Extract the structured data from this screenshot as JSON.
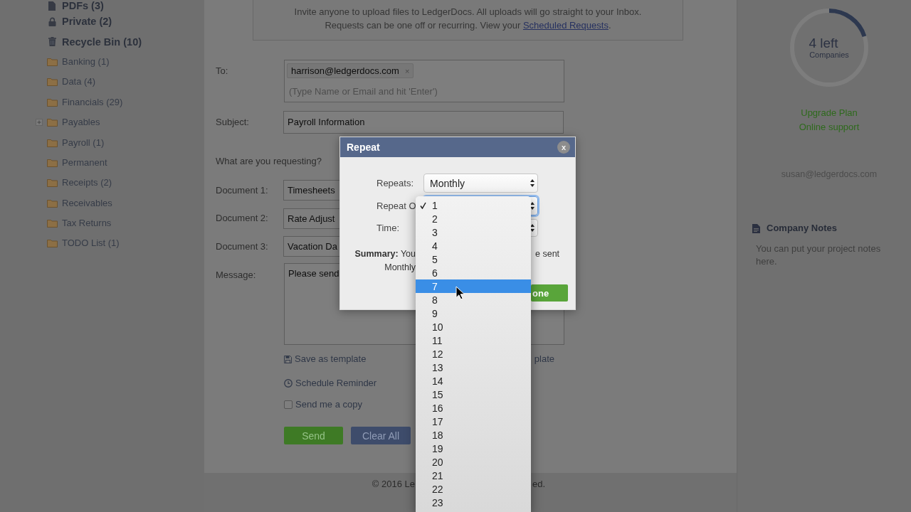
{
  "sidebar": {
    "items": [
      {
        "kind": "pdf",
        "label": "PDFs (3)"
      },
      {
        "kind": "private",
        "label": "Private (2)"
      },
      {
        "kind": "trash",
        "label": "Recycle Bin (10)"
      },
      {
        "kind": "folder",
        "label": "Banking (1)"
      },
      {
        "kind": "folder",
        "label": "Data (4)"
      },
      {
        "kind": "folder",
        "label": "Financials (29)"
      },
      {
        "kind": "folder",
        "label": "Payables",
        "expanded": false
      },
      {
        "kind": "folder",
        "label": "Payroll (1)"
      },
      {
        "kind": "folder",
        "label": "Permanent"
      },
      {
        "kind": "folder",
        "label": "Receipts (2)"
      },
      {
        "kind": "folder",
        "label": "Receivables"
      },
      {
        "kind": "folder",
        "label": "Tax Returns"
      },
      {
        "kind": "folder",
        "label": "TODO List (1)"
      }
    ]
  },
  "notice": {
    "line_1": "Invite anyone to upload files to LedgerDocs. All uploads will go straight to your Inbox.",
    "line_2": "Requests can be one off or recurring. View your",
    "link": "Scheduled Requests",
    "end": "."
  },
  "request_form": {
    "to": {
      "label": "To:",
      "recipients": [
        {
          "email": "harrison@ledgerdocs.com",
          "remove": "×"
        }
      ],
      "placeholder": "(Type Name or Email and hit 'Enter')"
    },
    "subject": {
      "label": "Subject:",
      "value": "Payroll Information"
    },
    "question": "What are you requesting?",
    "documents": [
      {
        "label": "Document 1:",
        "value": "Timesheets"
      },
      {
        "label": "Document 2:",
        "value": "Rate Adjust"
      },
      {
        "label": "Document 3:",
        "value": "Vacation Da"
      }
    ],
    "message": {
      "label": "Message:",
      "value": "Please send"
    },
    "template_links": [
      {
        "kind": "save",
        "label": "Save as template"
      },
      {
        "kind": "text",
        "label": "plate"
      }
    ],
    "reminder": {
      "label": "Schedule Reminder"
    },
    "copy": {
      "label": "Send me a copy",
      "checked": false
    },
    "buttons": [
      {
        "kind": "primary",
        "label": "Send"
      },
      {
        "kind": "secondary",
        "label": "Clear All"
      }
    ]
  },
  "footer": {
    "text_left": "© 2016 Le",
    "text_right": "ed."
  },
  "right_panel": {
    "usage": {
      "level": 0.2,
      "value": "4 left",
      "label": "Companies"
    },
    "links": [
      "Upgrade Plan",
      "Online support"
    ],
    "user_email": "susan@ledgerdocs.com",
    "notes": {
      "title": "Company Notes",
      "text": "You can put your project notes here."
    }
  },
  "repeat_dialog": {
    "title": "Repeat",
    "close": "x",
    "fields": [
      {
        "label": "Repeats:",
        "value": "Monthly",
        "focused": false
      },
      {
        "label": "Repeat O",
        "focused": true
      },
      {
        "label": "Time:",
        "focused": false
      }
    ],
    "summary_left": "**Summary:** You",
    "summary_right": "e sent",
    "summary_line_2": "Monthly",
    "done_button": "one"
  },
  "option_list": {
    "options": [
      {
        "label": "1",
        "checked": true,
        "selected": false
      },
      {
        "label": "2",
        "checked": false,
        "selected": false
      },
      {
        "label": "3",
        "checked": false,
        "selected": false
      },
      {
        "label": "4",
        "checked": false,
        "selected": false
      },
      {
        "label": "5",
        "checked": false,
        "selected": false
      },
      {
        "label": "6",
        "checked": false,
        "selected": false
      },
      {
        "label": "7",
        "checked": false,
        "selected": true
      },
      {
        "label": "8",
        "checked": false,
        "selected": false
      },
      {
        "label": "9",
        "checked": false,
        "selected": false
      },
      {
        "label": "10",
        "checked": false,
        "selected": false
      },
      {
        "label": "11",
        "checked": false,
        "selected": false
      },
      {
        "label": "12",
        "checked": false,
        "selected": false
      },
      {
        "label": "13",
        "checked": false,
        "selected": false
      },
      {
        "label": "14",
        "checked": false,
        "selected": false
      },
      {
        "label": "15",
        "checked": false,
        "selected": false
      },
      {
        "label": "16",
        "checked": false,
        "selected": false
      },
      {
        "label": "17",
        "checked": false,
        "selected": false
      },
      {
        "label": "18",
        "checked": false,
        "selected": false
      },
      {
        "label": "19",
        "checked": false,
        "selected": false
      },
      {
        "label": "20",
        "checked": false,
        "selected": false
      },
      {
        "label": "21",
        "checked": false,
        "selected": false
      },
      {
        "label": "22",
        "checked": false,
        "selected": false
      },
      {
        "label": "23",
        "checked": false,
        "selected": false
      }
    ]
  }
}
